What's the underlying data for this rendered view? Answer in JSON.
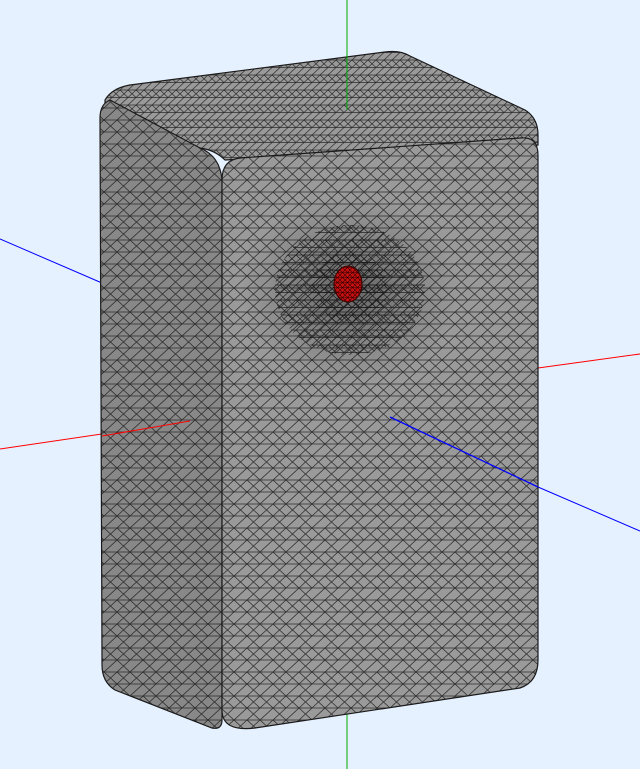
{
  "viewport": {
    "background": "#e6f1ff"
  },
  "axes": {
    "x_axis_color": "#ff0000",
    "y_axis_color": "#00aa00",
    "z_axis_color": "#0000ff"
  },
  "mesh": {
    "element_type": "triangle",
    "face_color": "#9a9a9a",
    "shadow_color": "#888888",
    "edge_color": "#000000",
    "highlight_region": {
      "color": "#c81010",
      "label": ""
    }
  }
}
